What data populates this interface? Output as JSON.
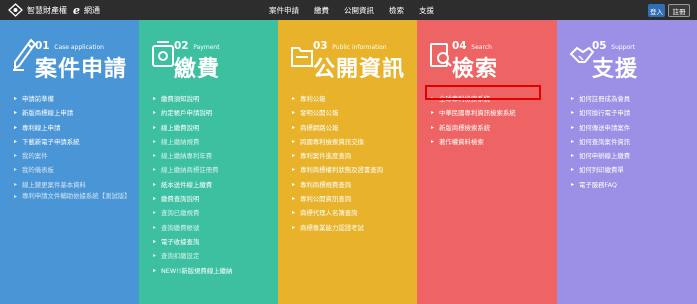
{
  "header": {
    "logo_text": "智慧財產權",
    "logo_e": "e",
    "logo_suffix": "網通",
    "nav": [
      "案件申請",
      "繳費",
      "公開資訊",
      "檢索",
      "支援"
    ],
    "login": "登入",
    "register": "註冊"
  },
  "columns": [
    {
      "num": "01",
      "en": "Case application",
      "title": "案件申請",
      "items": [
        {
          "label": "申請前準備",
          "dim": false
        },
        {
          "label": "新版商標線上申請",
          "dim": false
        },
        {
          "label": "專利線上申請",
          "dim": false
        },
        {
          "label": "下載新電子申請系統",
          "dim": false
        },
        {
          "label": "我的案件",
          "dim": true
        },
        {
          "label": "我的儀表板",
          "dim": true
        },
        {
          "label": "線上變更案件基本資料",
          "dim": true
        },
        {
          "label": "專利申請文件輔助依據系統【測試版】",
          "dim": true
        }
      ]
    },
    {
      "num": "02",
      "en": "Payment",
      "title": "繳費",
      "items": [
        {
          "label": "繳費須知說明",
          "dim": false
        },
        {
          "label": "約定帳戶申請說明",
          "dim": false
        },
        {
          "label": "線上繳費說明",
          "dim": false
        },
        {
          "label": "線上繳納規費",
          "dim": true
        },
        {
          "label": "線上繳納專利年費",
          "dim": true
        },
        {
          "label": "線上繳納商標註冊費",
          "dim": true
        },
        {
          "label": "紙本送件線上繳費",
          "dim": false
        },
        {
          "label": "繳費查詢說明",
          "dim": false
        },
        {
          "label": "查詢已繳規費",
          "dim": true
        },
        {
          "label": "查詢繳費帳號",
          "dim": true
        },
        {
          "label": "電子收據查詢",
          "dim": false
        },
        {
          "label": "查詢扣繳設定",
          "dim": true
        },
        {
          "label": "NEW!!新版規費線上繳納",
          "dim": false
        }
      ]
    },
    {
      "num": "03",
      "en": "Public information",
      "title": "公開資訊",
      "items": [
        {
          "label": "專利公報"
        },
        {
          "label": "發明公開公報"
        },
        {
          "label": "商標網路公報"
        },
        {
          "label": "跨國專利檢索資訊交換"
        },
        {
          "label": "專利案件進度查詢"
        },
        {
          "label": "專利商標權利狀態及證書查詢"
        },
        {
          "label": "專利商標規費查詢"
        },
        {
          "label": "專利公開資訊查詢"
        },
        {
          "label": "商標代理人名簿查詢"
        },
        {
          "label": "商標專業能力認證考試"
        }
      ]
    },
    {
      "num": "04",
      "en": "Search",
      "title": "檢索",
      "items": [
        {
          "label": "全球專利檢索系統"
        },
        {
          "label": "中華民國專利資訊檢索系統"
        },
        {
          "label": "新版商標檢索系統"
        },
        {
          "label": "著作權資料檢索"
        }
      ]
    },
    {
      "num": "05",
      "en": "Support",
      "title": "支援",
      "items": [
        {
          "label": "如何註冊成為會員"
        },
        {
          "label": "如何換行電子申請"
        },
        {
          "label": "如何傳送申請案件"
        },
        {
          "label": "如何查詢案件資訊"
        },
        {
          "label": "如何申辦線上繳費"
        },
        {
          "label": "如何列印繳費單"
        },
        {
          "label": "電子服務FAQ"
        }
      ]
    }
  ]
}
